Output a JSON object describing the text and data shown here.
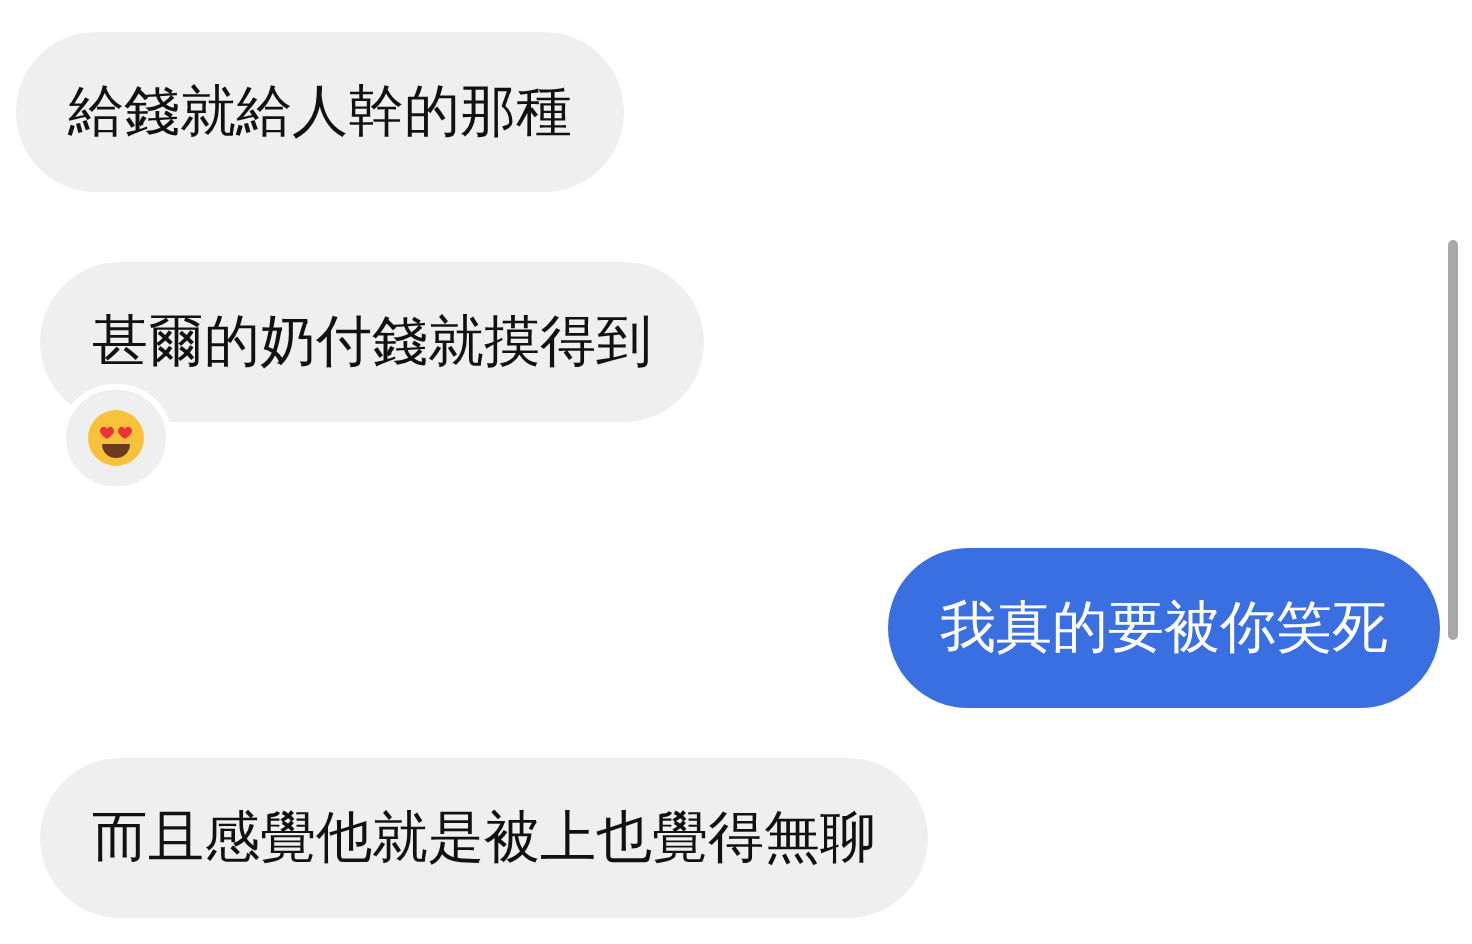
{
  "messages": [
    {
      "text": "給錢就給人幹的那種",
      "kind": "incoming",
      "reaction": false
    },
    {
      "text": "甚爾的奶付錢就摸得到",
      "kind": "incoming",
      "reaction": true
    },
    {
      "text": "我真的要被你笑死",
      "kind": "outgoing",
      "reaction": false
    },
    {
      "text": "而且感覺他就是被上也覺得無聊",
      "kind": "incoming",
      "reaction": false
    }
  ]
}
